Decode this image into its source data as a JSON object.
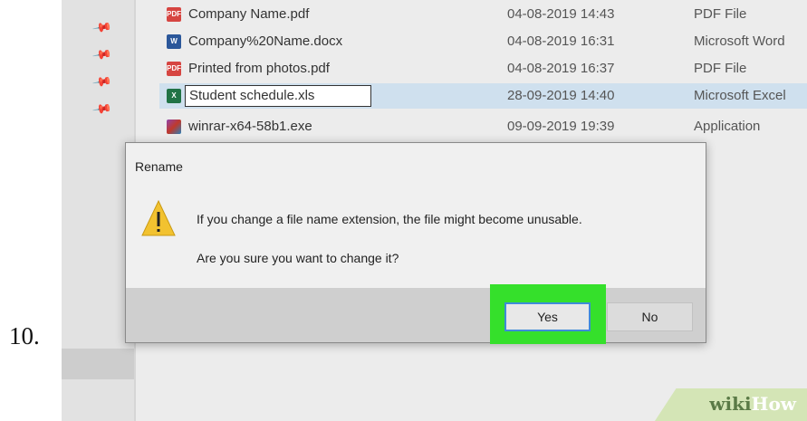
{
  "step_number": "10.",
  "files": [
    {
      "name": "Company Name.pdf",
      "date": "04-08-2019 14:43",
      "type": "PDF File",
      "icon": "pdf-icon"
    },
    {
      "name": "Company%20Name.docx",
      "date": "04-08-2019 16:31",
      "type": "Microsoft Word",
      "icon": "word-icon"
    },
    {
      "name": "Printed from photos.pdf",
      "date": "04-08-2019 16:37",
      "type": "PDF File",
      "icon": "pdf-icon"
    },
    {
      "name": "Student schedule.xls",
      "date": "28-09-2019 14:40",
      "type": "Microsoft Excel",
      "icon": "excel-icon",
      "selected": true,
      "renaming": true
    },
    {
      "name": "winrar-x64-58b1.exe",
      "date": "09-09-2019 19:39",
      "type": "Application",
      "icon": "exe-icon"
    }
  ],
  "dialog": {
    "title": "Rename",
    "message": "If you change a file name extension, the file might become unusable.",
    "question": "Are you sure you want to change it?",
    "yes_label": "Yes",
    "no_label": "No"
  },
  "watermark": {
    "wiki": "wiki",
    "how": "How"
  },
  "colors": {
    "highlight": "#35e02b",
    "selected_row": "#cfe0ee",
    "warning": "#f2c230"
  }
}
